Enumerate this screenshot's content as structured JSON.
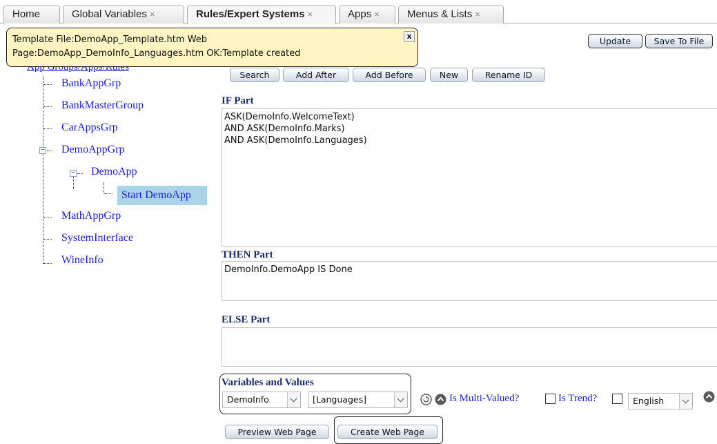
{
  "tabs": [
    {
      "label": "Home",
      "closable": false
    },
    {
      "label": "Global Variables",
      "closable": true
    },
    {
      "label": "Rules/Expert Systems",
      "closable": true,
      "active": true
    },
    {
      "label": "Apps",
      "closable": true
    },
    {
      "label": "Menus & Lists",
      "closable": true
    }
  ],
  "tab_close_glyph": "×",
  "notice": {
    "line1": "Template File:DemoApp_Template.htm Web",
    "line2": "Page:DemoApp_DemoInfo_Languages.htm OK:Template created",
    "close_label": "x"
  },
  "tree": {
    "root_label": "App Groups/Apps/Rules",
    "items": {
      "bank_app_grp": "BankAppGrp",
      "bank_master_group": "BankMasterGroup",
      "car_apps_grp": "CarAppsGrp",
      "demo_app_grp": "DemoAppGrp",
      "demo_app": "DemoApp",
      "start_demo_app": "Start DemoApp",
      "math_app_grp": "MathAppGrp",
      "system_interface": "SystemInterface",
      "wine_info": "WineInfo"
    },
    "expander_glyph": "−"
  },
  "toolbar": {
    "update": "Update",
    "save_to_file": "Save To File",
    "search": "Search",
    "add_after": "Add After",
    "add_before": "Add Before",
    "new": "New",
    "rename_id": "Rename ID"
  },
  "if_part": {
    "label": "IF Part",
    "text": "ASK(DemoInfo.WelcomeText)\nAND ASK(DemoInfo.Marks)\nAND ASK(DemoInfo.Languages)"
  },
  "then_part": {
    "label": "THEN Part",
    "text": "DemoInfo.DemoApp IS Done"
  },
  "else_part": {
    "label": "ELSE Part",
    "text": ""
  },
  "variables": {
    "label": "Variables and Values",
    "object_select": "DemoInfo",
    "variable_select": "[Languages]",
    "is_multi_valued": "Is Multi-Valued?",
    "is_trend": "Is Trend?",
    "language_select": "English"
  },
  "bottom_buttons": {
    "preview": "Preview Web Page",
    "create": "Create Web Page"
  },
  "icons": [
    "close-icon",
    "refresh-icon",
    "up-arrow-icon",
    "chevron-down-icon"
  ]
}
